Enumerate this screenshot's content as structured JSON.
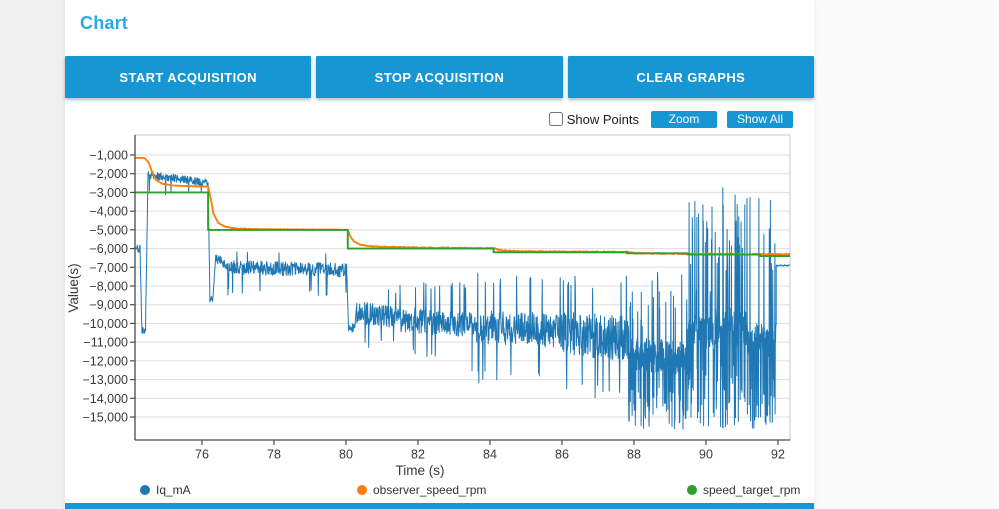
{
  "page": {
    "title": "Chart"
  },
  "toolbar": {
    "start_label": "START ACQUISITION",
    "stop_label": "STOP ACQUISITION",
    "clear_label": "CLEAR GRAPHS"
  },
  "controls": {
    "show_points_label": "Show Points",
    "show_points_checked": false,
    "zoom_label": "Zoom",
    "show_all_label": "Show All"
  },
  "colors": {
    "accent_blue": "#1697d4",
    "title_cyan": "#29abe2",
    "series_blue": "#1f77b4",
    "series_orange": "#ff7f0e",
    "series_green": "#2ca02c",
    "grid": "#dedede",
    "axis_dark": "#4a4a4a",
    "axis_light": "#c8c8c8",
    "tick_text": "#3a3a3a"
  },
  "legend": {
    "items": [
      {
        "label": "Iq_mA",
        "color": "#1f77b4"
      },
      {
        "label": "observer_speed_rpm",
        "color": "#ff7f0e"
      },
      {
        "label": "speed_target_rpm",
        "color": "#2ca02c"
      }
    ]
  },
  "chart_data": {
    "type": "line",
    "title": "",
    "xlabel": "Time (s)",
    "ylabel": "Value(s)",
    "xlim": [
      74.15,
      92.33
    ],
    "ylim": [
      -16230,
      70
    ],
    "x_ticks": [
      76,
      78,
      80,
      82,
      84,
      86,
      88,
      90,
      92
    ],
    "y_ticks": [
      -1000,
      -2000,
      -3000,
      -4000,
      -5000,
      -6000,
      -7000,
      -8000,
      -9000,
      -10000,
      -11000,
      -12000,
      -13000,
      -14000,
      -15000
    ],
    "grid": "horizontal-only",
    "legend_position": "bottom",
    "series": [
      {
        "name": "Iq_mA",
        "color": "#1f77b4",
        "style": "noise",
        "seed": 11,
        "clamp": [
          -15700,
          -1600
        ],
        "envelope": [
          {
            "t0": 74.15,
            "t1": 74.28,
            "c0": -6000,
            "c1": -6000,
            "a": 260
          },
          {
            "t0": 74.28,
            "t1": 74.33,
            "c0": -6100,
            "c1": -10350,
            "a": 50
          },
          {
            "t0": 74.33,
            "t1": 74.43,
            "c0": -10350,
            "c1": -10350,
            "a": 200
          },
          {
            "t0": 74.43,
            "t1": 74.5,
            "c0": -10350,
            "c1": -2100,
            "a": 40
          },
          {
            "t0": 74.5,
            "t1": 76.17,
            "c0": -2060,
            "c1": -2480,
            "a": 210,
            "downp": 0.035,
            "down": -3150
          },
          {
            "t0": 76.17,
            "t1": 76.22,
            "c0": -2480,
            "c1": -8750,
            "a": 30
          },
          {
            "t0": 76.22,
            "t1": 76.3,
            "c0": -8700,
            "c1": -8700,
            "a": 170
          },
          {
            "t0": 76.3,
            "t1": 76.38,
            "c0": -8700,
            "c1": -6450,
            "a": 40
          },
          {
            "t0": 76.38,
            "t1": 76.7,
            "c0": -6500,
            "c1": -6900,
            "a": 260
          },
          {
            "t0": 76.7,
            "t1": 80.02,
            "c0": -7000,
            "c1": -7150,
            "a": 370,
            "downp": 0.02,
            "down": -8500,
            "upp": 0.02,
            "up": -6050
          },
          {
            "t0": 80.02,
            "t1": 80.07,
            "c0": -7200,
            "c1": -10300,
            "a": 40
          },
          {
            "t0": 80.07,
            "t1": 80.24,
            "c0": -10250,
            "c1": -10250,
            "a": 240
          },
          {
            "t0": 80.24,
            "t1": 80.3,
            "c0": -10250,
            "c1": -8950,
            "a": 40
          },
          {
            "t0": 80.3,
            "t1": 81.5,
            "c0": -9400,
            "c1": -9750,
            "a": 600,
            "downp": 0.03,
            "down": -11300,
            "upp": 0.03,
            "up": -8100
          },
          {
            "t0": 81.5,
            "t1": 83.5,
            "c0": -9800,
            "c1": -10100,
            "a": 680,
            "downp": 0.04,
            "down": -11900,
            "upp": 0.04,
            "up": -7700
          },
          {
            "t0": 83.5,
            "t1": 86.0,
            "c0": -10150,
            "c1": -10400,
            "a": 900,
            "downp": 0.05,
            "down": -13200,
            "upp": 0.05,
            "up": -7200
          },
          {
            "t0": 86.0,
            "t1": 87.85,
            "c0": -10550,
            "c1": -10800,
            "a": 1200,
            "downp": 0.06,
            "down": -14100,
            "upp": 0.05,
            "up": -7300
          },
          {
            "t0": 87.85,
            "t1": 89.5,
            "c0": -11600,
            "c1": -11900,
            "a": 900,
            "spiky": true,
            "pd": 0.22,
            "pu": 0.1,
            "down": -15650,
            "up": -7000
          },
          {
            "t0": 89.5,
            "t1": 90.25,
            "c0": -10500,
            "c1": -10500,
            "a": 900,
            "spiky": true,
            "pd": 0.2,
            "pu": 0.14,
            "down": -15650,
            "up": -3200
          },
          {
            "t0": 90.25,
            "t1": 91.15,
            "c0": -10200,
            "c1": -10200,
            "a": 1000,
            "spiky": true,
            "pd": 0.24,
            "pu": 0.16,
            "down": -15650,
            "up": -2700
          },
          {
            "t0": 91.15,
            "t1": 91.95,
            "c0": -10900,
            "c1": -10900,
            "a": 900,
            "spiky": true,
            "pd": 0.2,
            "pu": 0.08,
            "down": -15650,
            "up": -2600
          },
          {
            "t0": 91.95,
            "t1": 92.33,
            "c0": -6900,
            "c1": -6900,
            "a": 35
          }
        ]
      },
      {
        "name": "observer_speed_rpm",
        "color": "#ff7f0e",
        "style": "line",
        "jitter": true,
        "points": [
          [
            74.15,
            -1150
          ],
          [
            74.4,
            -1160
          ],
          [
            74.52,
            -1400
          ],
          [
            74.62,
            -1950
          ],
          [
            74.72,
            -2330
          ],
          [
            74.9,
            -2540
          ],
          [
            75.2,
            -2630
          ],
          [
            75.7,
            -2670
          ],
          [
            76.17,
            -2690
          ],
          [
            76.24,
            -3300
          ],
          [
            76.32,
            -4150
          ],
          [
            76.45,
            -4620
          ],
          [
            76.62,
            -4820
          ],
          [
            76.9,
            -4920
          ],
          [
            77.4,
            -4960
          ],
          [
            78.5,
            -4980
          ],
          [
            80.05,
            -4995
          ],
          [
            80.12,
            -5350
          ],
          [
            80.22,
            -5620
          ],
          [
            80.38,
            -5780
          ],
          [
            80.6,
            -5860
          ],
          [
            81.0,
            -5910
          ],
          [
            82.0,
            -5950
          ],
          [
            83.0,
            -5970
          ],
          [
            84.1,
            -5990
          ],
          [
            84.3,
            -6090
          ],
          [
            84.8,
            -6140
          ],
          [
            85.5,
            -6160
          ],
          [
            86.5,
            -6170
          ],
          [
            87.8,
            -6185
          ],
          [
            88.1,
            -6255
          ],
          [
            89.0,
            -6270
          ],
          [
            90.0,
            -6285
          ],
          [
            91.0,
            -6295
          ],
          [
            92.33,
            -6310
          ]
        ]
      },
      {
        "name": "speed_target_rpm",
        "color": "#2ca02c",
        "style": "step",
        "points": [
          [
            74.15,
            -3000
          ],
          [
            76.17,
            -3000
          ],
          [
            76.17,
            -5000
          ],
          [
            80.05,
            -5000
          ],
          [
            80.05,
            -6000
          ],
          [
            84.1,
            -6000
          ],
          [
            84.1,
            -6200
          ],
          [
            87.8,
            -6200
          ],
          [
            87.8,
            -6250
          ],
          [
            89.5,
            -6250
          ],
          [
            89.5,
            -6320
          ],
          [
            91.5,
            -6320
          ],
          [
            91.5,
            -6400
          ],
          [
            92.33,
            -6400
          ]
        ]
      }
    ]
  }
}
